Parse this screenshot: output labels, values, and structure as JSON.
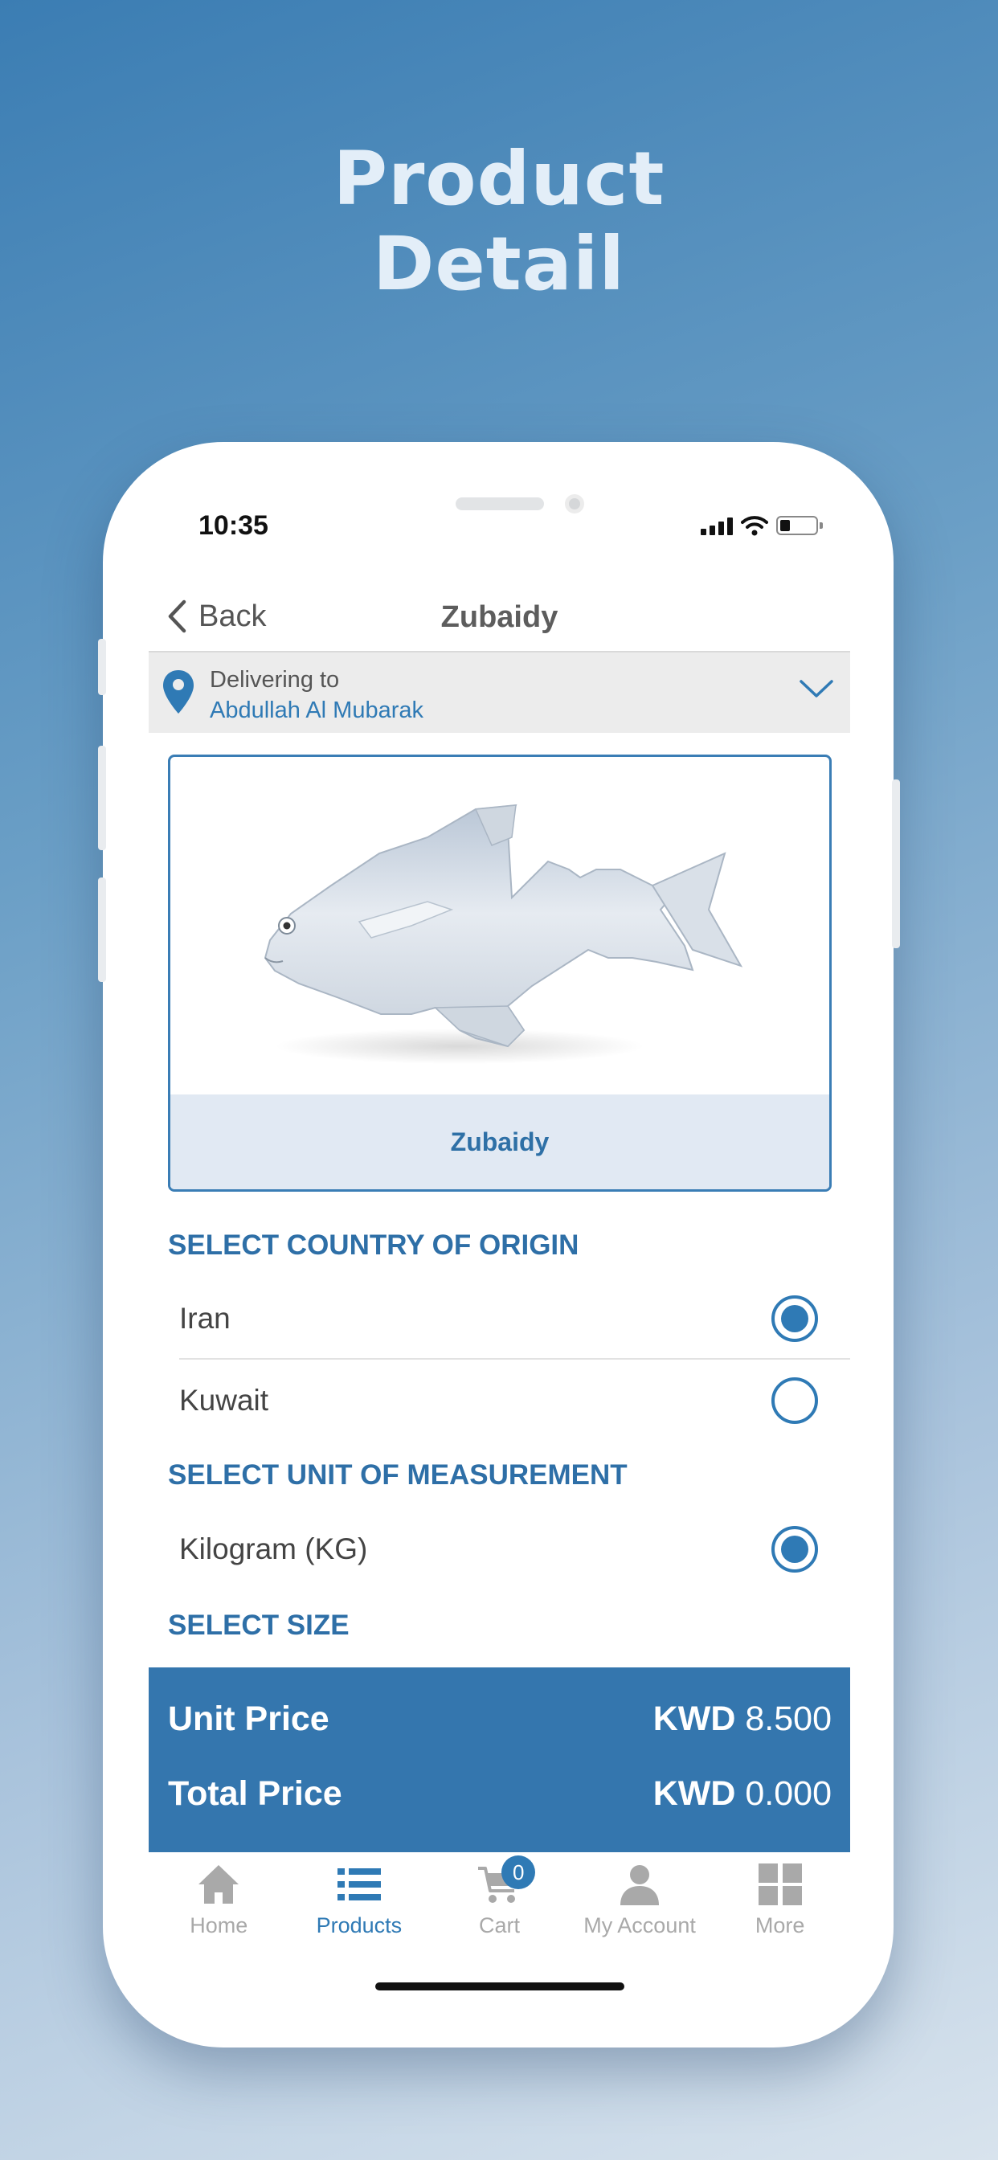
{
  "promo": {
    "title_line1": "Product",
    "title_line2": "Detail"
  },
  "status_bar": {
    "time": "10:35",
    "icons": [
      "cellular-signal-icon",
      "wifi-icon",
      "battery-icon"
    ]
  },
  "navbar": {
    "back_label": "Back",
    "title": "Zubaidy"
  },
  "delivery": {
    "label": "Delivering to",
    "location": "Abdullah Al Mubarak"
  },
  "product": {
    "name": "Zubaidy",
    "image_icon": "fish-photo"
  },
  "origin_section": {
    "title": "SELECT COUNTRY OF ORIGIN",
    "options": [
      {
        "label": "Iran",
        "selected": true
      },
      {
        "label": "Kuwait",
        "selected": false
      }
    ]
  },
  "unit_section": {
    "title": "SELECT UNIT OF MEASUREMENT",
    "options": [
      {
        "label": "Kilogram (KG)",
        "selected": true
      }
    ]
  },
  "size_section": {
    "title": "SELECT SIZE"
  },
  "pricing": {
    "unit_price_label": "Unit Price",
    "unit_price_currency": "KWD",
    "unit_price_amount": "8.500",
    "total_price_label": "Total Price",
    "total_price_currency": "KWD",
    "total_price_amount": "0.000"
  },
  "tabbar": {
    "items": [
      {
        "label": "Home",
        "icon": "home-icon",
        "active": false
      },
      {
        "label": "Products",
        "icon": "list-icon",
        "active": true
      },
      {
        "label": "Cart",
        "icon": "cart-icon",
        "active": false,
        "badge": "0"
      },
      {
        "label": "My Account",
        "icon": "user-icon",
        "active": false
      },
      {
        "label": "More",
        "icon": "grid-icon",
        "active": false
      }
    ]
  },
  "colors": {
    "accent": "#2f7ab5",
    "price_bar": "#3476ae",
    "caption_bg": "#e1e9f3",
    "delivery_bg": "#ececec"
  }
}
